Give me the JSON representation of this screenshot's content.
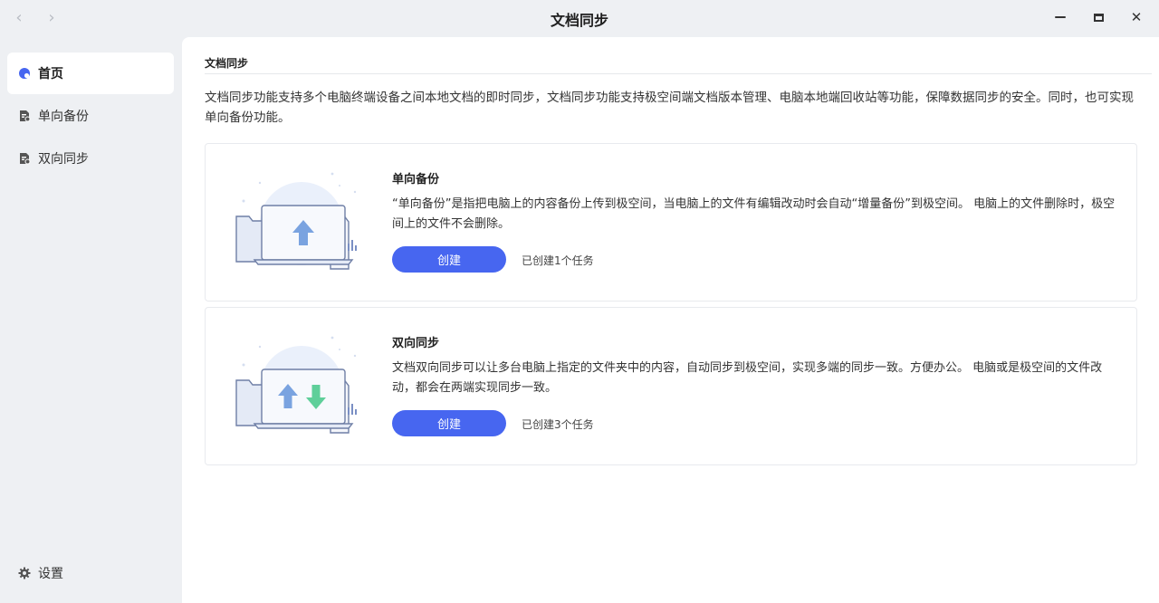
{
  "window": {
    "title": "文档同步",
    "back_icon": "‹",
    "forward_icon": "›",
    "close_icon": "✕"
  },
  "sidebar": {
    "items": [
      {
        "label": "首页",
        "icon": "home-icon",
        "active": true
      },
      {
        "label": "单向备份",
        "icon": "backup-icon",
        "active": false
      },
      {
        "label": "双向同步",
        "icon": "sync-icon",
        "active": false
      }
    ],
    "settings_label": "设置"
  },
  "main": {
    "section_title": "文档同步",
    "intro": "文档同步功能支持多个电脑终端设备之间本地文档的即时同步，文档同步功能支持极空间端文档版本管理、电脑本地端回收站等功能，保障数据同步的安全。同时，也可实现单向备份功能。",
    "cards": [
      {
        "title": "单向备份",
        "description": "“单向备份”是指把电脑上的内容备份上传到极空间，当电脑上的文件有编辑改动时会自动“增量备份”到极空间。 电脑上的文件删除时，极空间上的文件不会删除。",
        "button_label": "创建",
        "task_status": "已创建1个任务"
      },
      {
        "title": "双向同步",
        "description": "文档双向同步可以让多台电脑上指定的文件夹中的内容，自动同步到极空间，实现多端的同步一致。方便办公。 电脑或是极空间的文件改动，都会在两端实现同步一致。",
        "button_label": "创建",
        "task_status": "已创建3个任务"
      }
    ]
  },
  "colors": {
    "accent": "#4766f0",
    "up_arrow": "#7aa3e0",
    "down_arrow": "#5fcf9a"
  }
}
